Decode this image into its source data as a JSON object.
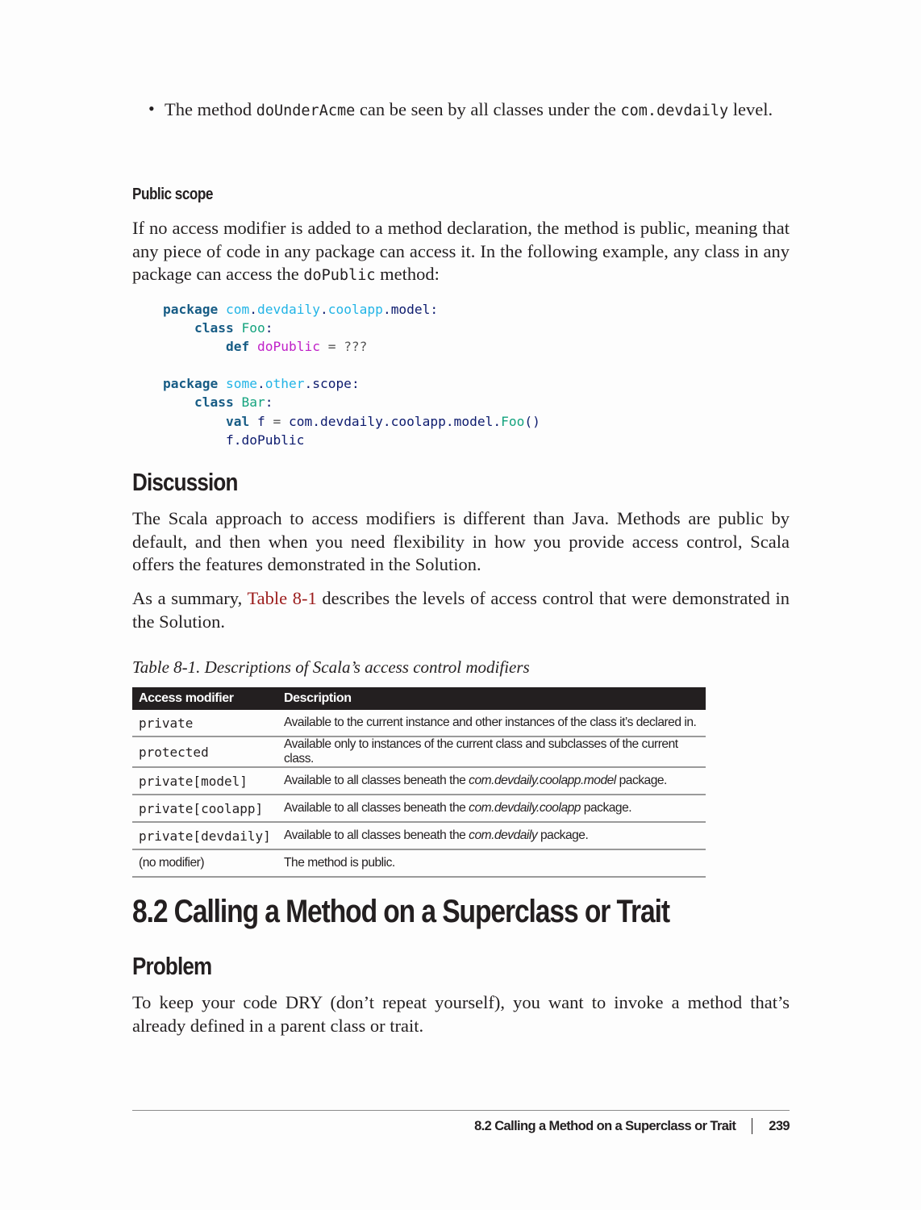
{
  "bullet": {
    "pre": "The method ",
    "code1": "doUnderAcme",
    "mid": " can be seen by all classes under the ",
    "code2": "com.devdaily",
    "post": " level."
  },
  "public_scope": {
    "heading": "Public scope",
    "para_pre": "If no access modifier is added to a method declaration, the method is public, meaning that any piece of code in any package can access it. In the following example, any class in any package can access the ",
    "para_code": "doPublic",
    "para_post": " method:"
  },
  "code": {
    "lines": [
      {
        "kw": "package",
        "pkg1": "com",
        "pkg2": "devdaily",
        "pkg3": "coolapp",
        "rest": "model"
      },
      {
        "kw": "class",
        "cls": "Foo"
      },
      {
        "kw": "def",
        "fn": "doPublic",
        "rest": "???"
      },
      {
        "kw": "package",
        "pkg1": "some",
        "pkg2": "other",
        "rest": "scope"
      },
      {
        "kw": "class",
        "cls": "Bar"
      },
      {
        "kw": "val",
        "var": "f",
        "path": "com.devdaily.coolapp.model.",
        "cls": "Foo",
        "tail": "()"
      },
      {
        "text": "f.doPublic"
      }
    ]
  },
  "discussion": {
    "heading": "Discussion",
    "para1": "The Scala approach to access modifiers is different than Java. Methods are public by default, and then when you need flexibility in how you provide access control, Scala offers the features demonstrated in the Solution.",
    "para2_pre": "As a summary, ",
    "para2_link": "Table 8-1",
    "para2_post": " describes the levels of access control that were demonstrated in the Solution."
  },
  "table": {
    "caption": "Table 8-1. Descriptions of Scala’s access control modifiers",
    "headers": [
      "Access modifier",
      "Description"
    ],
    "rows": [
      {
        "modifier": "private",
        "pre": "Available to the current instance and other instances of the class it’s declared in.",
        "it": "",
        "post": ""
      },
      {
        "modifier": "protected",
        "pre": "Available only to instances of the current class and subclasses of the current class.",
        "it": "",
        "post": ""
      },
      {
        "modifier": "private[model]",
        "pre": "Available to all classes beneath the ",
        "it": "com.devdaily.coolapp.model",
        "post": " package."
      },
      {
        "modifier": "private[coolapp]",
        "pre": "Available to all classes beneath the ",
        "it": "com.devdaily.coolapp",
        "post": " package."
      },
      {
        "modifier": "private[devdaily]",
        "pre": "Available to all classes beneath the ",
        "it": "com.devdaily",
        "post": " package."
      },
      {
        "modifier": "(no modifier)",
        "pre": "The method is public.",
        "it": "",
        "post": ""
      }
    ]
  },
  "section": {
    "title": "8.2 Calling a Method on a Superclass or Trait",
    "problem_heading": "Problem",
    "problem_text": "To keep your code DRY (don’t repeat yourself), you want to invoke a method that’s already defined in a parent class or trait."
  },
  "footer": {
    "running_title": "8.2 Calling a Method on a Superclass or Trait",
    "page_number": "239"
  }
}
